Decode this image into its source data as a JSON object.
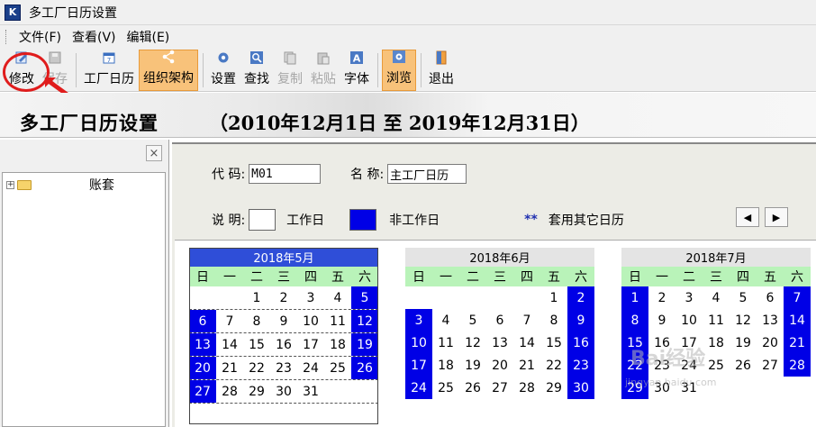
{
  "window": {
    "title": "多工厂日历设置"
  },
  "menu": [
    {
      "label": "文件(F)"
    },
    {
      "label": "查看(V)"
    },
    {
      "label": "编辑(E)"
    }
  ],
  "toolbar": {
    "modify": "修改",
    "save": "保存",
    "factory_calendar": "工厂日历",
    "org_structure": "组织架构",
    "settings": "设置",
    "find": "查找",
    "copy": "复制",
    "paste": "粘贴",
    "font": "字体",
    "browse": "浏览",
    "exit": "退出"
  },
  "header": {
    "title": "多工厂日历设置",
    "range": "（2010年12月1日  至  2019年12月31日）"
  },
  "sidebar": {
    "close": "×",
    "tree_root": "账套"
  },
  "form": {
    "code_label": "代    码:",
    "code_value": "M01",
    "name_label": "名    称:",
    "name_value": "主工厂日历",
    "legend_label": "说    明:",
    "workday": "工作日",
    "nonworkday": "非工作日",
    "other_marker": "**",
    "other_text": "套用其它日历",
    "prev": "◀",
    "next": "▶"
  },
  "colors": {
    "nonworkday": "#0000e6",
    "weekday_header": "#b9f3b9",
    "selected_month": "#2f4ed8",
    "active_tool": "#f8c27a"
  },
  "weekdays": [
    "日",
    "一",
    "二",
    "三",
    "四",
    "五",
    "六"
  ],
  "calendars": [
    {
      "title": "2018年5月",
      "selected": true,
      "weeks": [
        [
          "",
          "",
          "1",
          "2",
          "3",
          "4",
          "5"
        ],
        [
          "6",
          "7",
          "8",
          "9",
          "10",
          "11",
          "12"
        ],
        [
          "13",
          "14",
          "15",
          "16",
          "17",
          "18",
          "19"
        ],
        [
          "20",
          "21",
          "22",
          "23",
          "24",
          "25",
          "26"
        ],
        [
          "27",
          "28",
          "29",
          "30",
          "31",
          "",
          ""
        ]
      ],
      "off": [
        "5",
        "6",
        "12",
        "13",
        "19",
        "20",
        "26",
        "27"
      ]
    },
    {
      "title": "2018年6月",
      "selected": false,
      "weeks": [
        [
          "",
          "",
          "",
          "",
          "",
          "1",
          "2"
        ],
        [
          "3",
          "4",
          "5",
          "6",
          "7",
          "8",
          "9"
        ],
        [
          "10",
          "11",
          "12",
          "13",
          "14",
          "15",
          "16"
        ],
        [
          "17",
          "18",
          "19",
          "20",
          "21",
          "22",
          "23"
        ],
        [
          "24",
          "25",
          "26",
          "27",
          "28",
          "29",
          "30"
        ]
      ],
      "off": [
        "2",
        "3",
        "9",
        "10",
        "16",
        "17",
        "23",
        "24",
        "30"
      ]
    },
    {
      "title": "2018年7月",
      "selected": false,
      "weeks": [
        [
          "1",
          "2",
          "3",
          "4",
          "5",
          "6",
          "7"
        ],
        [
          "8",
          "9",
          "10",
          "11",
          "12",
          "13",
          "14"
        ],
        [
          "15",
          "16",
          "17",
          "18",
          "19",
          "20",
          "21"
        ],
        [
          "22",
          "23",
          "24",
          "25",
          "26",
          "27",
          "28"
        ],
        [
          "29",
          "30",
          "31",
          "",
          "",
          "",
          ""
        ]
      ],
      "off": [
        "1",
        "7",
        "8",
        "14",
        "15",
        "21",
        "22",
        "28",
        "29"
      ]
    }
  ],
  "watermark": {
    "text": "Bai经验",
    "url": "jingyan.baidu.com"
  }
}
